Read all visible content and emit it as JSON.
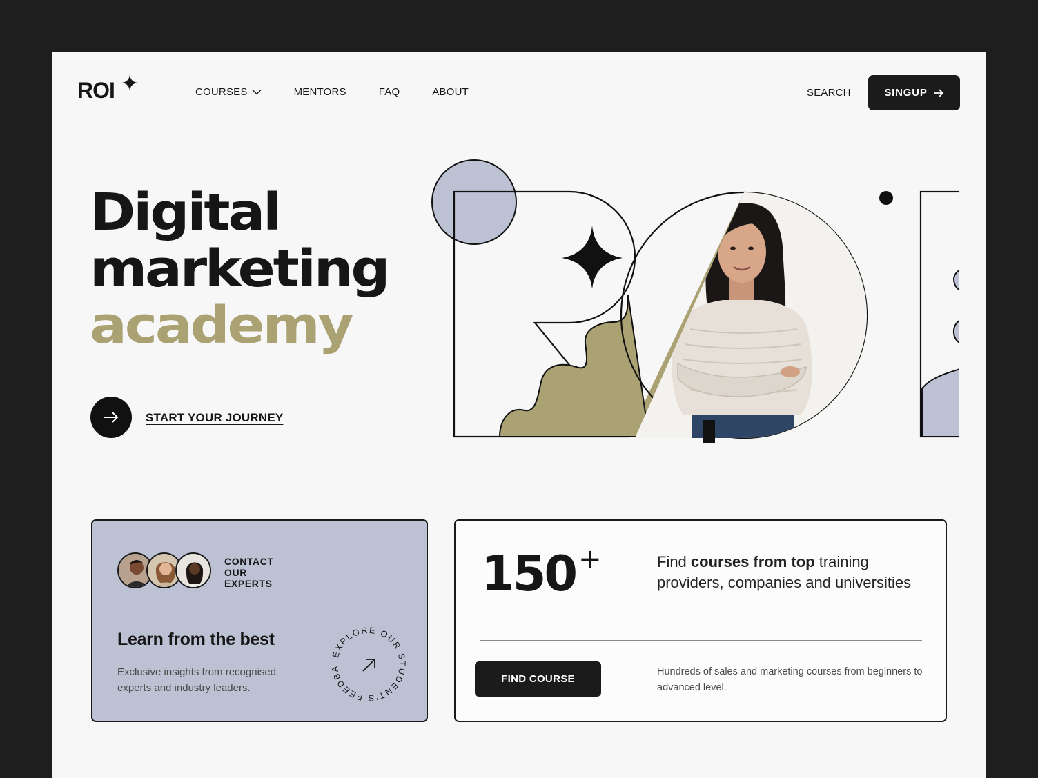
{
  "brand": {
    "logo_text": "ROI"
  },
  "nav": {
    "items": [
      {
        "label": "COURSES",
        "has_dropdown": true
      },
      {
        "label": "MENTORS"
      },
      {
        "label": "FAQ"
      },
      {
        "label": "ABOUT"
      }
    ],
    "search_label": "SEARCH",
    "signup_label": "SINGUP"
  },
  "hero": {
    "title_line1": "Digital",
    "title_line2": "marketing",
    "title_line3": "academy",
    "cta_label": "START YOUR JOURNEY"
  },
  "expert_card": {
    "contact_line1": "CONTACT",
    "contact_line2": "OUR",
    "contact_line3": "EXPERTS",
    "title": "Learn from the best",
    "description": "Exclusive insights from recognised experts and industry leaders.",
    "badge_text": "EXPLORE OUR STUDENT'S FEEDBACK"
  },
  "courses_card": {
    "number": "150",
    "number_suffix": "+",
    "headline_pre": "Find ",
    "headline_bold": "courses from top",
    "headline_post": " training providers, companies and universities",
    "button_label": "FIND COURSE",
    "description": "Hundreds of sales and marketing courses from beginners to advanced level."
  },
  "colors": {
    "background_frame": "#1e1e1e",
    "page": "#f7f7f7",
    "accent_olive": "#aba274",
    "accent_lavender": "#bcc1d4",
    "dark": "#1b1b1b"
  },
  "icons": [
    "sparkle-star-icon",
    "chevron-down-icon",
    "arrow-right-icon",
    "arrow-up-right-icon"
  ]
}
